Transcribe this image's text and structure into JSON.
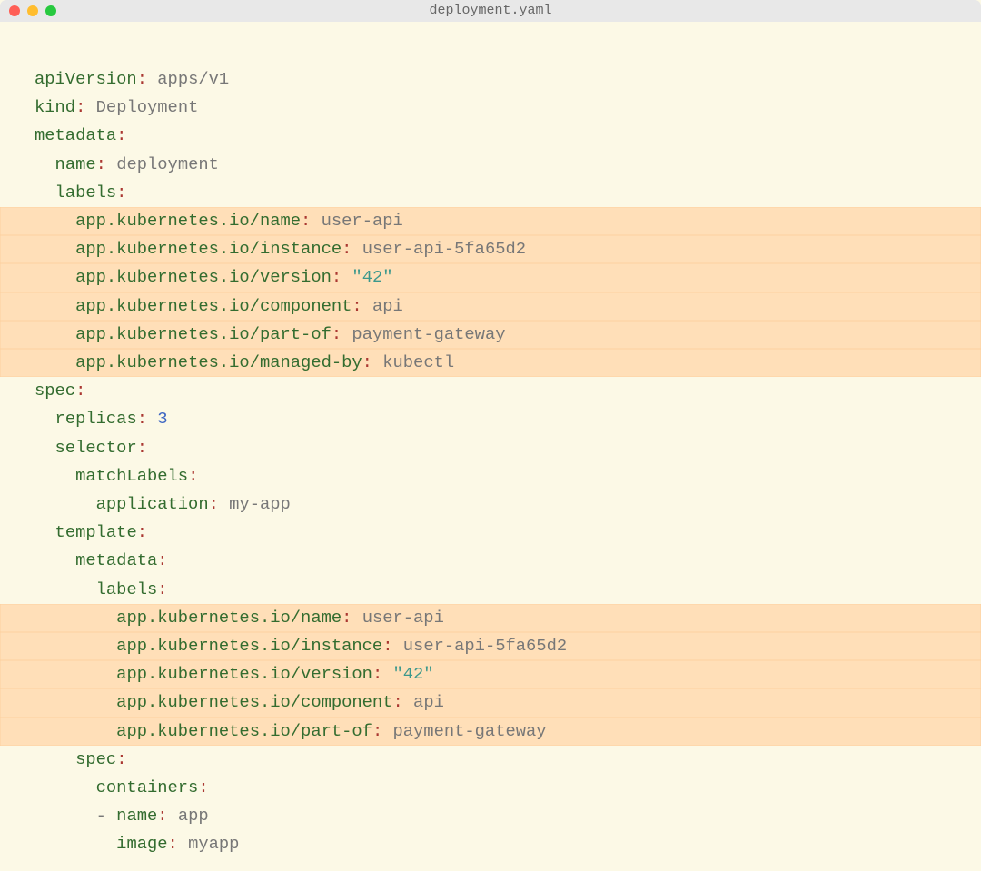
{
  "titlebar": {
    "title": "deployment.yaml"
  },
  "layout": [
    {
      "indent": 0,
      "hl": false,
      "key": "apiVersion",
      "value": "apps/v1",
      "valKind": "plain"
    },
    {
      "indent": 0,
      "hl": false,
      "key": "kind",
      "value": "Deployment",
      "valKind": "plain"
    },
    {
      "indent": 0,
      "hl": false,
      "key": "metadata",
      "value": null,
      "valKind": "none"
    },
    {
      "indent": 1,
      "hl": false,
      "key": "name",
      "value": "deployment",
      "valKind": "plain"
    },
    {
      "indent": 1,
      "hl": false,
      "key": "labels",
      "value": null,
      "valKind": "none"
    },
    {
      "indent": 2,
      "hl": true,
      "key": "app.kubernetes.io/name",
      "value": "user-api",
      "valKind": "plain"
    },
    {
      "indent": 2,
      "hl": true,
      "key": "app.kubernetes.io/instance",
      "value": "user-api-5fa65d2",
      "valKind": "plain"
    },
    {
      "indent": 2,
      "hl": true,
      "key": "app.kubernetes.io/version",
      "value": "\"42\"",
      "valKind": "string"
    },
    {
      "indent": 2,
      "hl": true,
      "key": "app.kubernetes.io/component",
      "value": "api",
      "valKind": "plain"
    },
    {
      "indent": 2,
      "hl": true,
      "key": "app.kubernetes.io/part-of",
      "value": "payment-gateway",
      "valKind": "plain"
    },
    {
      "indent": 2,
      "hl": true,
      "key": "app.kubernetes.io/managed-by",
      "value": "kubectl",
      "valKind": "plain"
    },
    {
      "indent": 0,
      "hl": false,
      "key": "spec",
      "value": null,
      "valKind": "none"
    },
    {
      "indent": 1,
      "hl": false,
      "key": "replicas",
      "value": "3",
      "valKind": "number"
    },
    {
      "indent": 1,
      "hl": false,
      "key": "selector",
      "value": null,
      "valKind": "none"
    },
    {
      "indent": 2,
      "hl": false,
      "key": "matchLabels",
      "value": null,
      "valKind": "none"
    },
    {
      "indent": 3,
      "hl": false,
      "key": "application",
      "value": "my-app",
      "valKind": "plain"
    },
    {
      "indent": 1,
      "hl": false,
      "key": "template",
      "value": null,
      "valKind": "none"
    },
    {
      "indent": 2,
      "hl": false,
      "key": "metadata",
      "value": null,
      "valKind": "none"
    },
    {
      "indent": 3,
      "hl": false,
      "key": "labels",
      "value": null,
      "valKind": "none"
    },
    {
      "indent": 4,
      "hl": true,
      "key": "app.kubernetes.io/name",
      "value": "user-api",
      "valKind": "plain"
    },
    {
      "indent": 4,
      "hl": true,
      "key": "app.kubernetes.io/instance",
      "value": "user-api-5fa65d2",
      "valKind": "plain"
    },
    {
      "indent": 4,
      "hl": true,
      "key": "app.kubernetes.io/version",
      "value": "\"42\"",
      "valKind": "string"
    },
    {
      "indent": 4,
      "hl": true,
      "key": "app.kubernetes.io/component",
      "value": "api",
      "valKind": "plain"
    },
    {
      "indent": 4,
      "hl": true,
      "key": "app.kubernetes.io/part-of",
      "value": "payment-gateway",
      "valKind": "plain"
    },
    {
      "indent": 2,
      "hl": false,
      "key": "spec",
      "value": null,
      "valKind": "none"
    },
    {
      "indent": 3,
      "hl": false,
      "key": "containers",
      "value": null,
      "valKind": "none"
    },
    {
      "indent": 3,
      "hl": false,
      "dash": true,
      "key": "name",
      "value": "app",
      "valKind": "plain"
    },
    {
      "indent": 4,
      "hl": false,
      "key": "image",
      "value": "myapp",
      "valKind": "plain"
    }
  ]
}
